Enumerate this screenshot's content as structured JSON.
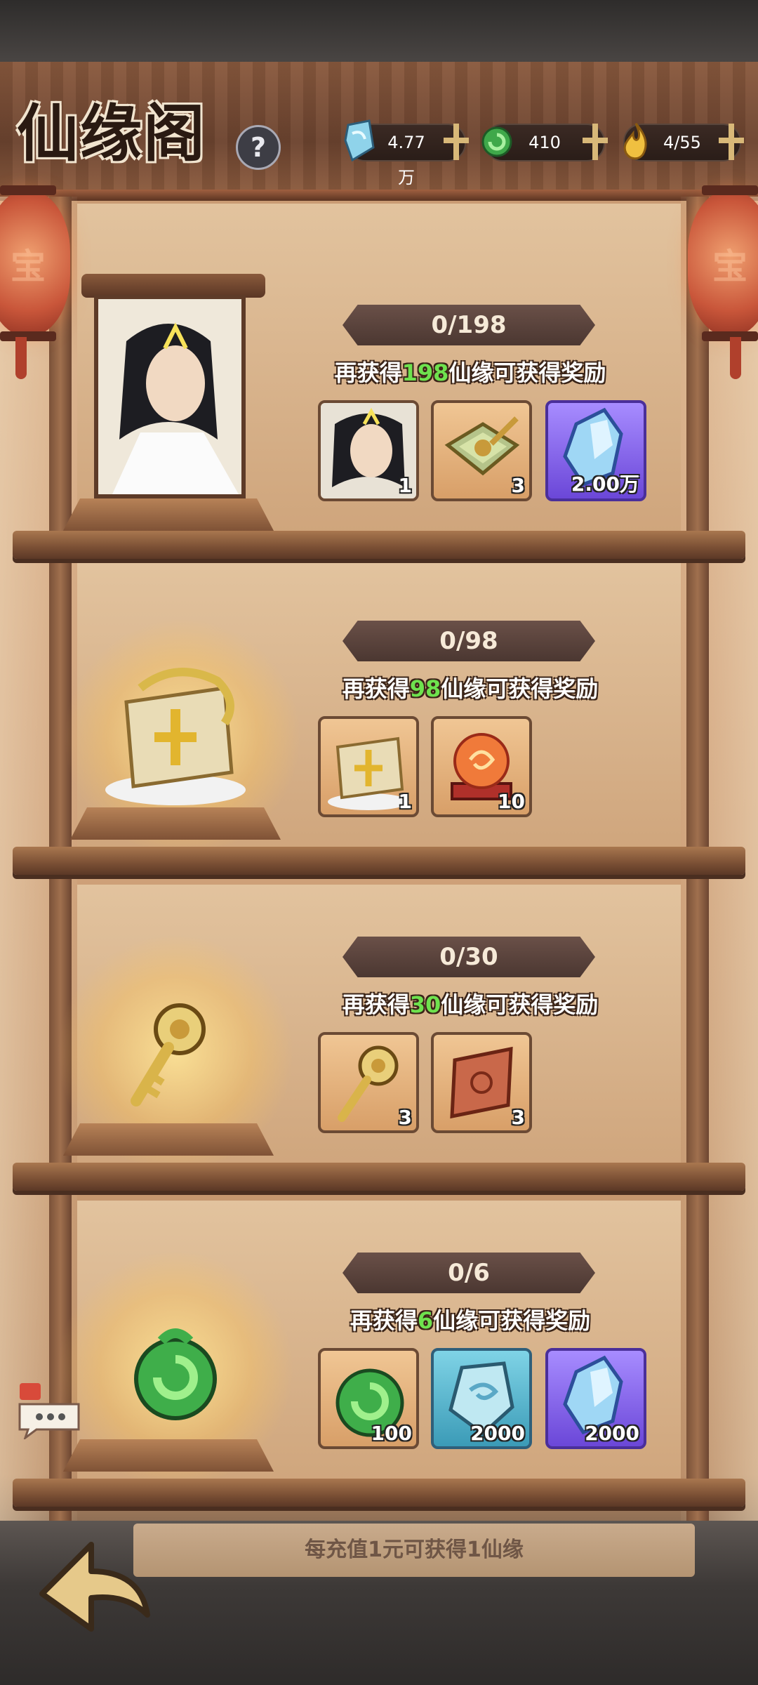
{
  "header": {
    "title": "仙缘阁",
    "help_label": "?"
  },
  "lanterns": {
    "left_text": "宝",
    "right_text": "宝"
  },
  "currencies": [
    {
      "icon": "crystal-icon",
      "value": "4.77万"
    },
    {
      "icon": "jade-coil-icon",
      "value": "410"
    },
    {
      "icon": "gold-flame-icon",
      "value": "4/55"
    }
  ],
  "tiers": [
    {
      "progress": "0/198",
      "desc_prefix": "再获得",
      "desc_num": "198",
      "desc_suffix": "仙缘可获得奖励",
      "feature": "hero-portrait",
      "rewards": [
        {
          "icon": "hero-portrait-icon",
          "qty": "1",
          "bg": "orange"
        },
        {
          "icon": "jade-token-icon",
          "qty": "3",
          "bg": "orange"
        },
        {
          "icon": "crystal-icon",
          "qty": "2.00万",
          "bg": "purple"
        }
      ]
    },
    {
      "progress": "0/98",
      "desc_prefix": "再获得",
      "desc_num": "98",
      "desc_suffix": "仙缘可获得奖励",
      "feature": "dragon-emblem",
      "rewards": [
        {
          "icon": "dragon-emblem-icon",
          "qty": "1",
          "bg": "orange"
        },
        {
          "icon": "red-orb-icon",
          "qty": "10",
          "bg": "orange"
        }
      ]
    },
    {
      "progress": "0/30",
      "desc_prefix": "再获得",
      "desc_num": "30",
      "desc_suffix": "仙缘可获得奖励",
      "feature": "golden-key",
      "rewards": [
        {
          "icon": "golden-key-icon",
          "qty": "3",
          "bg": "orange"
        },
        {
          "icon": "red-scroll-icon",
          "qty": "3",
          "bg": "orange"
        }
      ]
    },
    {
      "progress": "0/6",
      "desc_prefix": "再获得",
      "desc_num": "6",
      "desc_suffix": "仙缘可获得奖励",
      "feature": "jade-coil",
      "rewards": [
        {
          "icon": "jade-coil-icon",
          "qty": "100",
          "bg": "orange"
        },
        {
          "icon": "blue-crystal-icon",
          "qty": "2000",
          "bg": "blue"
        },
        {
          "icon": "crystal-icon",
          "qty": "2000",
          "bg": "purple"
        }
      ]
    }
  ],
  "footer": {
    "info": "每充值1元可获得1仙缘"
  },
  "colors": {
    "highlight_number": "#6ee24e",
    "banner": "#4b3731",
    "wood": "#7a4f34"
  }
}
